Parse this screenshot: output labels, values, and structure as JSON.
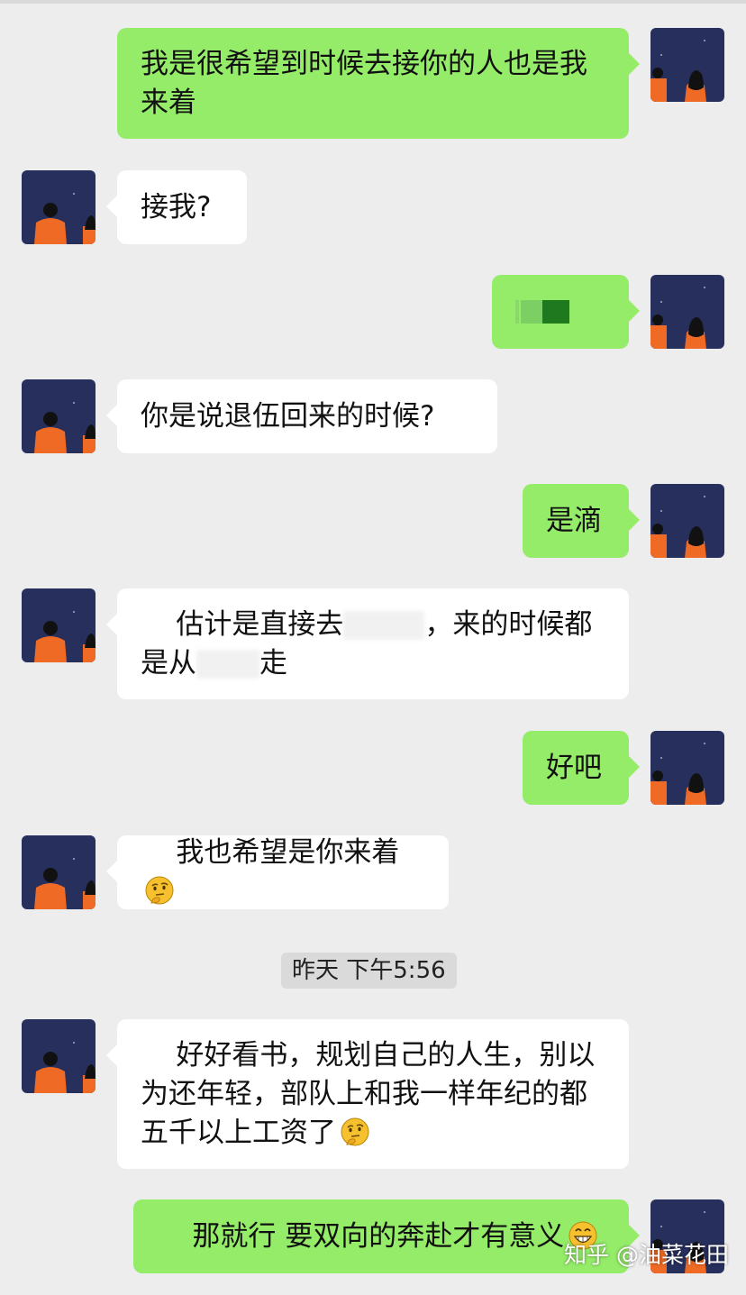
{
  "messages": [
    {
      "side": "right",
      "text": "我是很希望到时候去接你的人也是我来着"
    },
    {
      "side": "left",
      "text": "接我?"
    },
    {
      "side": "right",
      "text": "",
      "redacted": true
    },
    {
      "side": "left",
      "text": "你是说退伍回来的时候?"
    },
    {
      "side": "right",
      "text": "是滴"
    },
    {
      "side": "left",
      "text_a": "估计是直接去",
      "text_b": "，来的时候都是从",
      "text_c": "走"
    },
    {
      "side": "right",
      "text": "好吧"
    },
    {
      "side": "left",
      "text": "我也希望是你来着",
      "emoji": "thinking-face-icon"
    },
    {
      "side": "left",
      "text": "好好看书，规划自己的人生，别以为还年轻，部队上和我一样年纪的都五千以上工资了",
      "emoji": "thinking-face-icon"
    },
    {
      "side": "right",
      "text": "那就行 要双向的奔赴才有意义",
      "emoji": "grinning-face-icon"
    }
  ],
  "timestamp": "昨天 下午5:56",
  "watermark": "知乎 @油菜花田",
  "colors": {
    "background": "#ededed",
    "bubble_self": "#95ec69",
    "bubble_other": "#ffffff",
    "timestamp_bg": "#dadada"
  }
}
